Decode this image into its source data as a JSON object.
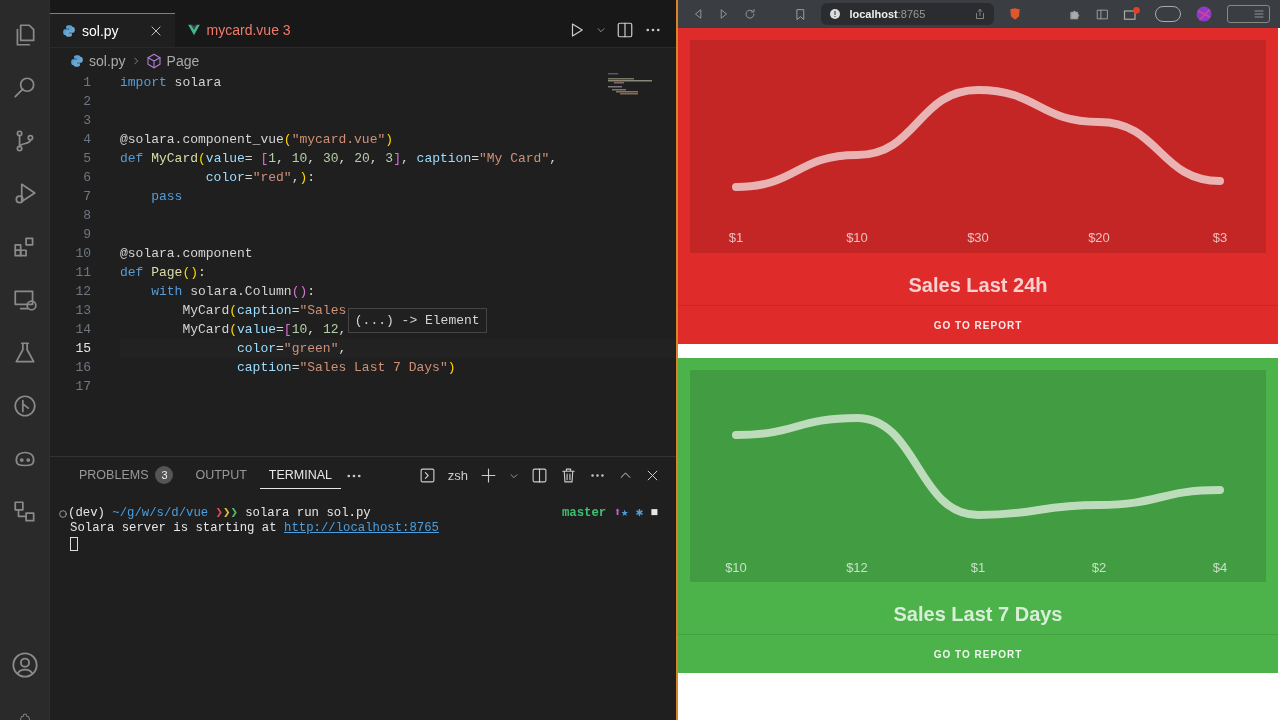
{
  "editor": {
    "tabs": [
      {
        "label": "sol.py",
        "kind": "python",
        "selected": true
      },
      {
        "label": "mycard.vue",
        "kind": "vue",
        "badge": "3",
        "selected": false
      }
    ],
    "breadcrumb": [
      "sol.py",
      "Page"
    ],
    "lines": [
      {
        "number": "1",
        "current": false,
        "tokens": [
          {
            "kind": "kw",
            "text": "import"
          },
          {
            "kind": "text",
            "text": " solara"
          }
        ]
      },
      {
        "number": "2",
        "current": false
      },
      {
        "number": "3",
        "current": false
      },
      {
        "number": "4",
        "current": false,
        "tokens": [
          {
            "kind": "text",
            "text": "@solara.component_vue"
          },
          {
            "kind": "br",
            "text": "("
          },
          {
            "kind": "str",
            "text": "\"mycard.vue\""
          },
          {
            "kind": "br",
            "text": ")"
          }
        ]
      },
      {
        "number": "5",
        "current": false,
        "tokens": [
          {
            "kind": "kw",
            "text": "def"
          },
          {
            "kind": "fn",
            "text": " MyCard"
          },
          {
            "kind": "br",
            "text": "("
          },
          {
            "kind": "param",
            "text": "value"
          },
          {
            "kind": "text",
            "text": "= "
          },
          {
            "kind": "br2",
            "text": "["
          },
          {
            "kind": "num",
            "text": "1"
          },
          {
            "kind": "text",
            "text": ", "
          },
          {
            "kind": "num",
            "text": "10"
          },
          {
            "kind": "text",
            "text": ", "
          },
          {
            "kind": "num",
            "text": "30"
          },
          {
            "kind": "text",
            "text": ", "
          },
          {
            "kind": "num",
            "text": "20"
          },
          {
            "kind": "text",
            "text": ", "
          },
          {
            "kind": "num",
            "text": "3"
          },
          {
            "kind": "br2",
            "text": "]"
          },
          {
            "kind": "text",
            "text": ", "
          },
          {
            "kind": "param",
            "text": "caption"
          },
          {
            "kind": "text",
            "text": "="
          },
          {
            "kind": "str",
            "text": "\"My Card\""
          },
          {
            "kind": "text",
            "text": ","
          }
        ]
      },
      {
        "number": "6",
        "current": false,
        "tokens": [
          {
            "kind": "param",
            "text": "           color"
          },
          {
            "kind": "text",
            "text": "="
          },
          {
            "kind": "str",
            "text": "\"red\""
          },
          {
            "kind": "text",
            "text": ","
          },
          {
            "kind": "br",
            "text": ")"
          },
          {
            "kind": "text",
            "text": ":"
          }
        ]
      },
      {
        "number": "7",
        "current": false,
        "tokens": [
          {
            "kind": "kw",
            "text": "    pass"
          }
        ]
      },
      {
        "number": "8",
        "current": false
      },
      {
        "number": "9",
        "current": false
      },
      {
        "number": "10",
        "current": false,
        "tokens": [
          {
            "kind": "text",
            "text": "@solara.component"
          }
        ]
      },
      {
        "number": "11",
        "current": false,
        "tokens": [
          {
            "kind": "kw",
            "text": "def"
          },
          {
            "kind": "fn",
            "text": " Page"
          },
          {
            "kind": "br",
            "text": "()"
          },
          {
            "kind": "text",
            "text": ":"
          }
        ]
      },
      {
        "number": "12",
        "current": false,
        "tokens": [
          {
            "kind": "kw",
            "text": "    with"
          },
          {
            "kind": "text",
            "text": " solara.Column"
          },
          {
            "kind": "br2",
            "text": "()"
          },
          {
            "kind": "text",
            "text": ":"
          }
        ]
      },
      {
        "number": "13",
        "current": false,
        "tokens": [
          {
            "kind": "text",
            "text": "        MyCard"
          },
          {
            "kind": "br",
            "text": "("
          },
          {
            "kind": "param",
            "text": "caption"
          },
          {
            "kind": "text",
            "text": "="
          },
          {
            "kind": "str",
            "text": "\"Sales"
          }
        ]
      },
      {
        "number": "14",
        "current": false,
        "tokens": [
          {
            "kind": "text",
            "text": "        MyCard"
          },
          {
            "kind": "br",
            "text": "("
          },
          {
            "kind": "param",
            "text": "value"
          },
          {
            "kind": "text",
            "text": "="
          },
          {
            "kind": "br2",
            "text": "["
          },
          {
            "kind": "num",
            "text": "10"
          },
          {
            "kind": "text",
            "text": ", "
          },
          {
            "kind": "num",
            "text": "12"
          },
          {
            "kind": "text",
            "text": ","
          }
        ]
      },
      {
        "number": "15",
        "current": true,
        "tokens": [
          {
            "kind": "param",
            "text": "               color"
          },
          {
            "kind": "text",
            "text": "="
          },
          {
            "kind": "str",
            "text": "\"green\""
          },
          {
            "kind": "text",
            "text": ","
          }
        ]
      },
      {
        "number": "16",
        "current": false,
        "tokens": [
          {
            "kind": "param",
            "text": "               caption"
          },
          {
            "kind": "text",
            "text": "="
          },
          {
            "kind": "str",
            "text": "\"Sales Last 7 Days\""
          },
          {
            "kind": "br",
            "text": ")"
          }
        ]
      },
      {
        "number": "17",
        "current": false
      }
    ],
    "tooltip": "(...) -> Element"
  },
  "panel": {
    "tabs": [
      {
        "label": "PROBLEMS",
        "badge": "3",
        "selected": false
      },
      {
        "label": "OUTPUT",
        "selected": false
      },
      {
        "label": "TERMINAL",
        "selected": true
      }
    ],
    "shell": "zsh",
    "terminal": [
      {
        "prompt": true,
        "tokens": [
          {
            "kind": "text",
            "text": "(dev) "
          },
          {
            "kind": "path",
            "text": "~/g/w/s/d/vue "
          },
          {
            "kind": "p1",
            "text": "❯"
          },
          {
            "kind": "p2",
            "text": "❯"
          },
          {
            "kind": "p3",
            "text": "❯ "
          },
          {
            "kind": "text",
            "text": "solara run sol.py"
          }
        ],
        "right": [
          {
            "kind": "branch",
            "text": "master "
          },
          {
            "kind": "up",
            "text": "⬆"
          },
          {
            "kind": "path",
            "text": "★ ✱ "
          },
          {
            "kind": "text",
            "text": "■"
          }
        ]
      },
      {
        "prompt": false,
        "tokens": [
          {
            "kind": "text",
            "text": "Solara server is starting at "
          },
          {
            "kind": "link",
            "text": "http://localhost:8765"
          }
        ]
      }
    ]
  },
  "browser": {
    "url": "**localhost**:8765",
    "cards": [
      {
        "title": "Sales Last 24h",
        "action": "GO TO REPORT",
        "color": "#e02b2b",
        "axis_labels": [
          "$1",
          "$10",
          "$30",
          "$20",
          "$3"
        ]
      },
      {
        "title": "Sales Last 7 Days",
        "action": "GO TO REPORT",
        "color": "#4cb24a",
        "axis_labels": [
          "$10",
          "$12",
          "$1",
          "$2",
          "$4"
        ]
      }
    ]
  }
}
